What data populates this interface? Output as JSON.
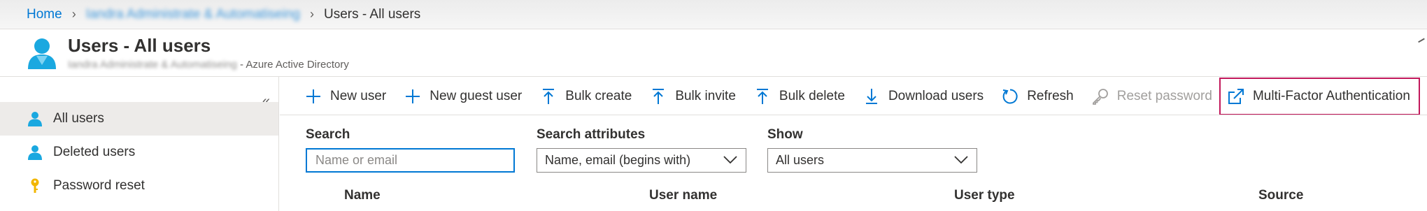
{
  "breadcrumb": {
    "home": "Home",
    "tenant": "Iandra Administrate & Automatiseing",
    "current": "Users - All users"
  },
  "header": {
    "title": "Users - All users",
    "subtitle_tenant": "Iandra Administrate & Automatiseing",
    "subtitle_suffix": " - Azure Active Directory"
  },
  "sidebar": {
    "collapse_glyph": "«",
    "items": [
      {
        "label": "All users",
        "icon": "user-icon"
      },
      {
        "label": "Deleted users",
        "icon": "user-icon"
      },
      {
        "label": "Password reset",
        "icon": "key-icon"
      }
    ]
  },
  "toolbar": {
    "new_user": "New user",
    "new_guest_user": "New guest user",
    "bulk_create": "Bulk create",
    "bulk_invite": "Bulk invite",
    "bulk_delete": "Bulk delete",
    "download_users": "Download users",
    "refresh": "Refresh",
    "reset_password": "Reset password",
    "mfa": "Multi-Factor Authentication"
  },
  "filters": {
    "search_label": "Search",
    "search_placeholder": "Name or email",
    "search_value": "",
    "attributes_label": "Search attributes",
    "attributes_value": "Name, email (begins with)",
    "show_label": "Show",
    "show_value": "All users"
  },
  "table": {
    "columns": [
      "Name",
      "User name",
      "User type",
      "Source"
    ]
  },
  "colors": {
    "accent": "#0078d4",
    "highlight_border": "#c2185b",
    "disabled_text": "#a19f9d"
  }
}
